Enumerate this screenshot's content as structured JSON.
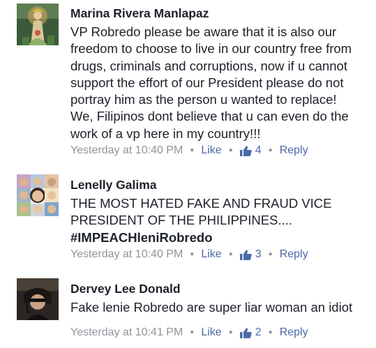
{
  "comments": [
    {
      "author": "Marina Rivera Manlapaz",
      "lines": [
        "VP Robredo please be aware that it is also our",
        "freedom to choose to live in our country free from",
        "drugs, criminals and corruptions, now if u cannot",
        "support the effort of our President please do not",
        "portray him as the person u wanted to replace!",
        "We, Filipinos dont believe that u can even do the",
        "work of a vp here in my country!!!"
      ],
      "timestamp": "Yesterday at 10:40 PM",
      "like_label": "Like",
      "like_count": "4",
      "reply_label": "Reply"
    },
    {
      "author": "Lenelly Galima",
      "lines": [
        "THE MOST HATED FAKE AND FRAUD VICE",
        "PRESIDENT OF THE PHILIPPINES....",
        "#IMPEACHleniRobredo"
      ],
      "timestamp": "Yesterday at 10:40 PM",
      "like_label": "Like",
      "like_count": "3",
      "reply_label": "Reply"
    },
    {
      "author": "Dervey Lee Donald",
      "lines": [
        "Fake lenie Robredo are super liar woman an idiot"
      ],
      "timestamp": "Yesterday at 10:41 PM",
      "like_label": "Like",
      "like_count": "2",
      "reply_label": "Reply"
    }
  ],
  "icons": {
    "like": "thumbs-up-icon",
    "separator": "dot"
  },
  "colors": {
    "link": "#4b6aa8",
    "meta": "#90949c",
    "text": "#1d2129"
  }
}
